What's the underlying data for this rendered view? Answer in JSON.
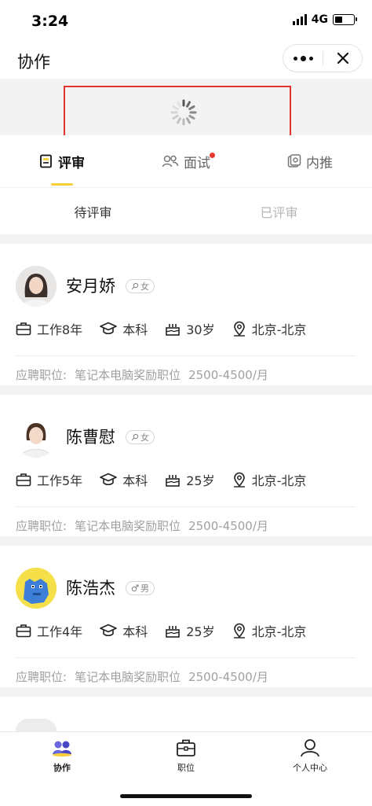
{
  "status_bar": {
    "time": "3:24",
    "network": "4G"
  },
  "nav": {
    "title": "协作"
  },
  "tabs": [
    {
      "label": "评审",
      "active": true,
      "icon": "review-doc-icon"
    },
    {
      "label": "面试",
      "active": false,
      "icon": "interview-people-icon",
      "has_badge": true
    },
    {
      "label": "内推",
      "active": false,
      "icon": "referral-icon"
    }
  ],
  "subtabs": [
    {
      "label": "待评审",
      "active": true
    },
    {
      "label": "已评审",
      "active": false
    }
  ],
  "candidates": [
    {
      "name": "安月娇",
      "gender": "女",
      "experience": "工作8年",
      "education": "本科",
      "age": "30岁",
      "location": "北京-北京",
      "apply_label": "应聘职位:",
      "position": "笔记本电脑奖励职位",
      "salary": "2500-4500/月"
    },
    {
      "name": "陈曹慰",
      "gender": "女",
      "experience": "工作5年",
      "education": "本科",
      "age": "25岁",
      "location": "北京-北京",
      "apply_label": "应聘职位:",
      "position": "笔记本电脑奖励职位",
      "salary": "2500-4500/月"
    },
    {
      "name": "陈浩杰",
      "gender": "男",
      "experience": "工作4年",
      "education": "本科",
      "age": "25岁",
      "location": "北京-北京",
      "apply_label": "应聘职位:",
      "position": "笔记本电脑奖励职位",
      "salary": "2500-4500/月"
    }
  ],
  "tabbar": [
    {
      "label": "协作",
      "active": true,
      "icon": "collab-icon"
    },
    {
      "label": "职位",
      "active": false,
      "icon": "briefcase-icon"
    },
    {
      "label": "个人中心",
      "active": false,
      "icon": "person-icon"
    }
  ],
  "colors": {
    "accent": "#f7cf3d",
    "badge": "#e8372f",
    "highlight_box": "#e0322e",
    "collab_icon": "#5a55d8"
  }
}
